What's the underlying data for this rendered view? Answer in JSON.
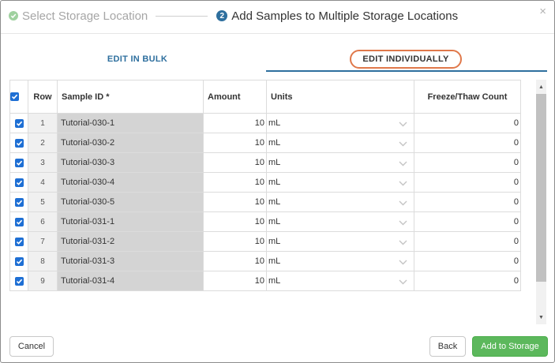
{
  "wizard": {
    "step1_label": "Select Storage Location",
    "step2_number": "2",
    "step2_label": "Add Samples to Multiple Storage Locations",
    "close_symbol": "×"
  },
  "tabs": {
    "bulk_label": "EDIT IN BULK",
    "individual_label": "EDIT INDIVIDUALLY",
    "active": "individual"
  },
  "grid": {
    "columns": {
      "row": "Row",
      "sample_id": "Sample ID  *",
      "amount": "Amount",
      "units": "Units",
      "freeze_thaw": "Freeze/Thaw Count"
    },
    "header_checked": true,
    "rows": [
      {
        "checked": true,
        "row": "1",
        "sample_id": "Tutorial-030-1",
        "amount": "10",
        "units": "mL",
        "freeze_thaw": "0"
      },
      {
        "checked": true,
        "row": "2",
        "sample_id": "Tutorial-030-2",
        "amount": "10",
        "units": "mL",
        "freeze_thaw": "0"
      },
      {
        "checked": true,
        "row": "3",
        "sample_id": "Tutorial-030-3",
        "amount": "10",
        "units": "mL",
        "freeze_thaw": "0"
      },
      {
        "checked": true,
        "row": "4",
        "sample_id": "Tutorial-030-4",
        "amount": "10",
        "units": "mL",
        "freeze_thaw": "0"
      },
      {
        "checked": true,
        "row": "5",
        "sample_id": "Tutorial-030-5",
        "amount": "10",
        "units": "mL",
        "freeze_thaw": "0"
      },
      {
        "checked": true,
        "row": "6",
        "sample_id": "Tutorial-031-1",
        "amount": "10",
        "units": "mL",
        "freeze_thaw": "0"
      },
      {
        "checked": true,
        "row": "7",
        "sample_id": "Tutorial-031-2",
        "amount": "10",
        "units": "mL",
        "freeze_thaw": "0"
      },
      {
        "checked": true,
        "row": "8",
        "sample_id": "Tutorial-031-3",
        "amount": "10",
        "units": "mL",
        "freeze_thaw": "0"
      },
      {
        "checked": true,
        "row": "9",
        "sample_id": "Tutorial-031-4",
        "amount": "10",
        "units": "mL",
        "freeze_thaw": "0"
      }
    ]
  },
  "footer": {
    "cancel_label": "Cancel",
    "back_label": "Back",
    "add_label": "Add to Storage"
  },
  "colors": {
    "accent": "#2e6f9e",
    "primary_button": "#5cb85c",
    "checkbox": "#1e6fd4",
    "highlight_ring": "#e0784a",
    "readonly_cell": "#d4d4d4"
  }
}
